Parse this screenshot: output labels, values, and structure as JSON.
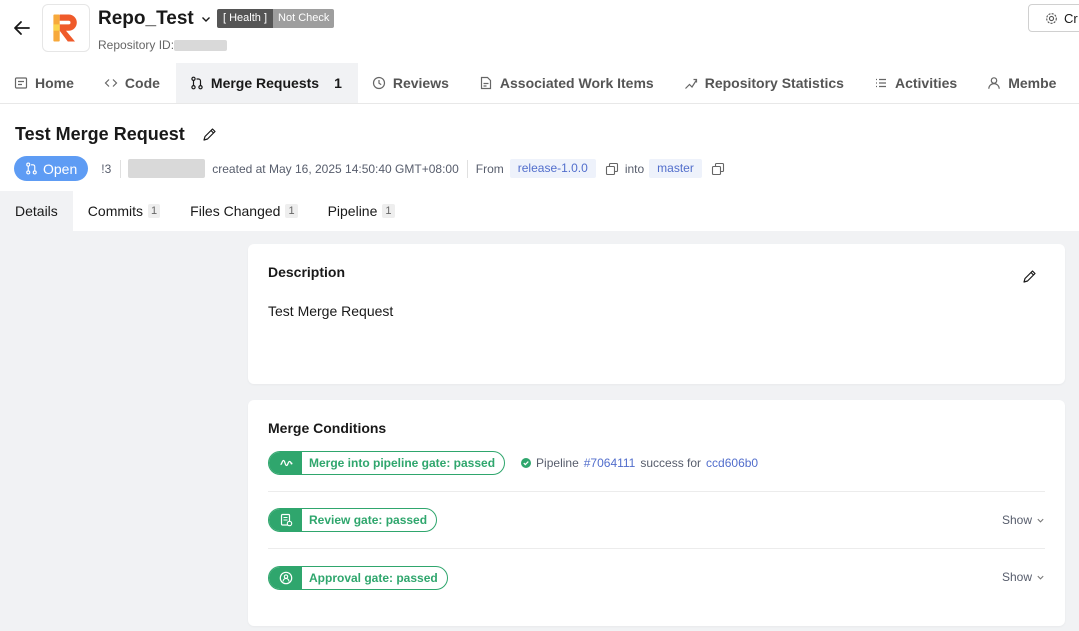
{
  "header": {
    "repo_name": "Repo_Test",
    "health_label": "[ Health ]",
    "health_status": "Not Check",
    "repo_id_label": "Repository ID:",
    "create_label": "Cr"
  },
  "nav": {
    "items": [
      {
        "label": "Home",
        "icon": "home-icon"
      },
      {
        "label": "Code",
        "icon": "code-icon"
      },
      {
        "label": "Merge Requests",
        "icon": "merge-request-icon",
        "count": "1",
        "active": true
      },
      {
        "label": "Reviews",
        "icon": "review-icon"
      },
      {
        "label": "Associated Work Items",
        "icon": "work-item-icon"
      },
      {
        "label": "Repository Statistics",
        "icon": "statistics-icon"
      },
      {
        "label": "Activities",
        "icon": "activities-icon"
      },
      {
        "label": "Membe",
        "icon": "member-icon"
      }
    ]
  },
  "mr": {
    "title": "Test Merge Request",
    "status": "Open",
    "number": "!3",
    "created": "created at May 16, 2025 14:50:40 GMT+08:00",
    "from_label": "From",
    "source_branch": "release-1.0.0",
    "into_label": "into",
    "target_branch": "master"
  },
  "subtabs": [
    {
      "label": "Details",
      "active": true
    },
    {
      "label": "Commits",
      "count": "1"
    },
    {
      "label": "Files Changed",
      "count": "1"
    },
    {
      "label": "Pipeline",
      "count": "1"
    }
  ],
  "description": {
    "heading": "Description",
    "text": "Test Merge Request"
  },
  "merge_conditions": {
    "heading": "Merge Conditions",
    "gates": [
      {
        "label": "Merge into pipeline gate: passed",
        "icon": "pipeline-gate-icon"
      },
      {
        "label": "Review gate: passed",
        "icon": "review-gate-icon",
        "show": "Show"
      },
      {
        "label": "Approval gate: passed",
        "icon": "approval-gate-icon",
        "show": "Show"
      }
    ],
    "pipeline": {
      "prefix": "Pipeline",
      "id": "#7064111",
      "middle": "success for",
      "commit": "ccd606b0"
    }
  },
  "colors": {
    "accent_blue": "#5e9cf4",
    "gate_green": "#2fa66d",
    "link_blue": "#526ecc",
    "page_bg": "#f1f2f4"
  }
}
